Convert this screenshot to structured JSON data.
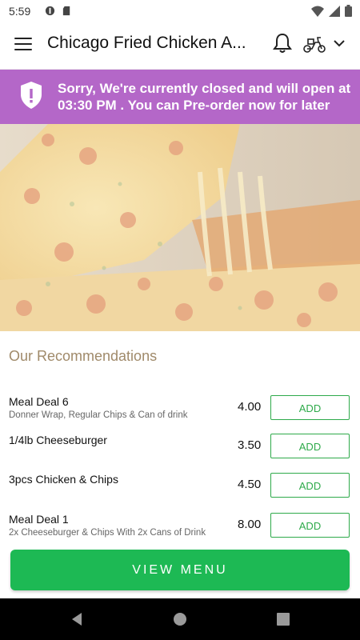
{
  "status_bar": {
    "time": "5:59"
  },
  "app_bar": {
    "title": "Chicago Fried Chicken A..."
  },
  "banner": {
    "message": "Sorry, We're currently closed and will open at 03:30 PM . You can Pre-order now for later",
    "color": "#b467c8"
  },
  "recommendations": {
    "title": "Our Recommendations",
    "items": [
      {
        "name": "Meal Deal 6",
        "description": "Donner Wrap, Regular Chips & Can of drink",
        "price": "4.00",
        "add_label": "ADD"
      },
      {
        "name": "1/4lb Cheeseburger",
        "description": "",
        "price": "3.50",
        "add_label": "ADD"
      },
      {
        "name": "3pcs Chicken & Chips",
        "description": "",
        "price": "4.50",
        "add_label": "ADD"
      },
      {
        "name": "Meal Deal 1",
        "description": "2x Cheeseburger & Chips With 2x Cans of Drink",
        "price": "8.00",
        "add_label": "ADD"
      }
    ]
  },
  "view_menu_label": "VIEW MENU",
  "colors": {
    "accent_green": "#1db954",
    "recommendation_title": "#a08a6a"
  },
  "icons": [
    "menu-icon",
    "bell-icon",
    "scooter-icon",
    "chevron-down-icon",
    "shield-alert-icon",
    "back-icon",
    "home-icon",
    "recents-icon"
  ]
}
